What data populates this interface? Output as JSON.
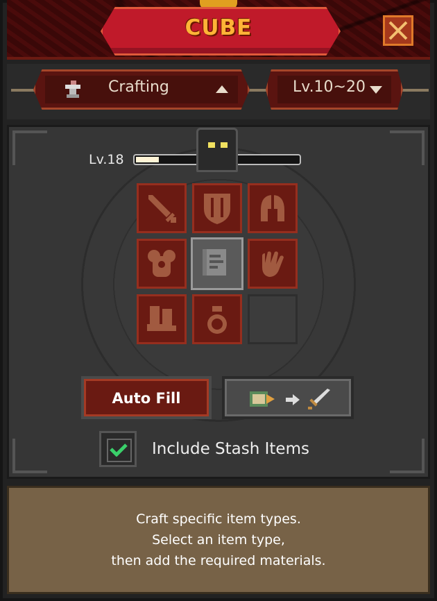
{
  "header": {
    "title": "CUBE",
    "close_icon": "close-icon"
  },
  "dropdowns": {
    "mode": {
      "label": "Crafting",
      "icon": "anvil-icon",
      "arrow": "up"
    },
    "level": {
      "label": "Lv.10~20",
      "arrow": "down"
    }
  },
  "cube": {
    "level_label": "Lv.18",
    "xp_fraction": 0.14
  },
  "slots": [
    {
      "name": "sword",
      "icon": "sword-icon"
    },
    {
      "name": "shield",
      "icon": "shield-icon"
    },
    {
      "name": "helmet",
      "icon": "helmet-icon"
    },
    {
      "name": "armor",
      "icon": "armor-icon"
    },
    {
      "name": "scroll",
      "icon": "scroll-icon",
      "selected": true
    },
    {
      "name": "gloves",
      "icon": "glove-icon"
    },
    {
      "name": "boots",
      "icon": "boots-icon"
    },
    {
      "name": "pouch",
      "icon": "pouch-icon"
    },
    {
      "name": "empty",
      "icon": ""
    }
  ],
  "buttons": {
    "auto_fill": "Auto Fill",
    "craft_icons": [
      "scroll-icon",
      "arrow-right-icon",
      "sword-icon"
    ]
  },
  "stash": {
    "label": "Include Stash Items",
    "checked": true
  },
  "description": {
    "lines": [
      "Craft specific item types.",
      "Select an item type,",
      "then add the required materials."
    ]
  },
  "colors": {
    "accent_red": "#c01a2a",
    "title_gold": "#ffb437",
    "slot_red": "#6a1a12",
    "check_green": "#3ad06a"
  }
}
